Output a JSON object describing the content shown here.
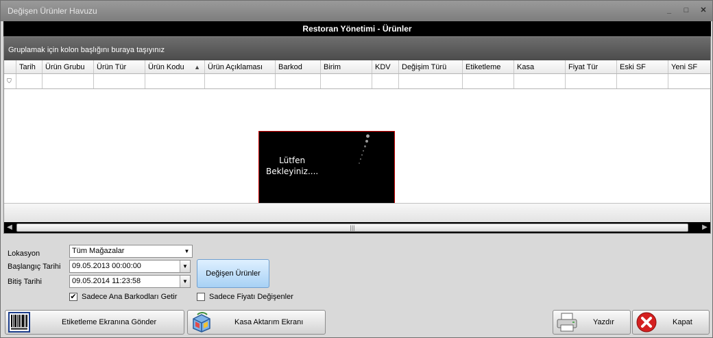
{
  "window": {
    "title": "Değişen Ürünler Havuzu",
    "controls": [
      "_",
      "□",
      "✕"
    ]
  },
  "header": {
    "title": "Restoran Yönetimi - Ürünler"
  },
  "grid": {
    "group_hint": "Gruplamak için kolon başlığını buraya taşıyınız",
    "columns": [
      "Tarih",
      "Ürün Grubu",
      "Ürün Tür",
      "Ürün Kodu",
      "Ürün Açıklaması",
      "Barkod",
      "Birim",
      "KDV",
      "Değişim Türü",
      "Etiketleme",
      "Kasa",
      "Fiyat Tür",
      "Eski SF",
      "Yeni SF"
    ],
    "sorted_column": "Ürün Kodu",
    "sort_glyph": "▲",
    "filter_glyph": "⛉",
    "scroll_thumb_glyph": "|||"
  },
  "loading": {
    "line1": "Lütfen",
    "line2": "Bekleyiniz...."
  },
  "form": {
    "lokasyon_label": "Lokasyon",
    "lokasyon_value": "Tüm Mağazalar",
    "start_label": "Başlangıç Tarihi",
    "start_value": "09.05.2013 00:00:00",
    "end_label": "Bitiş Tarihi",
    "end_value": "09.05.2014 11:23:58",
    "changed_button": "Değişen Ürünler",
    "only_main_barcodes": {
      "label": "Sadece Ana Barkodları Getir",
      "checked": true
    },
    "only_price_changed": {
      "label": "Sadece Fiyatı Değişenler",
      "checked": false
    }
  },
  "buttons": {
    "label_screen": "Etiketleme Ekranına Gönder",
    "cash_transfer": "Kasa Aktarım Ekranı",
    "print": "Yazdır",
    "close": "Kapat"
  },
  "icons": [
    "barcode-icon",
    "box-transfer-icon",
    "printer-icon",
    "close-x-icon"
  ],
  "colors": {
    "header_bg": "#000000",
    "button_blue": "#a7d1f5",
    "close_red": "#d42020"
  }
}
